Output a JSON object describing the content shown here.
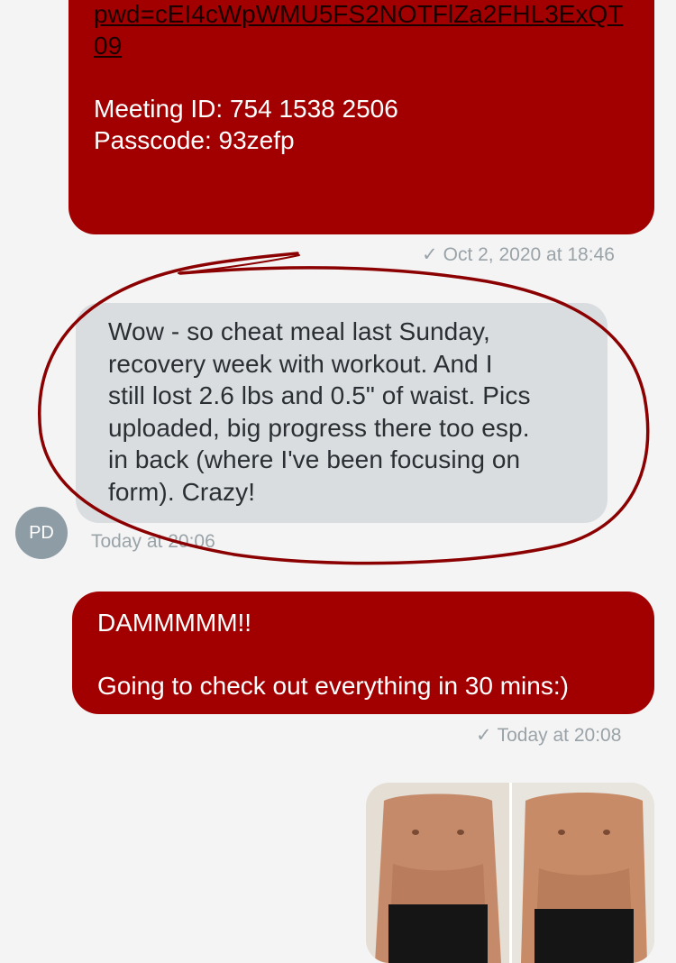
{
  "messages": [
    {
      "link_text": "pwd=cEI4cWpWMU5FS2NOTFlZa2FHL3ExQT09",
      "meeting_id": "Meeting ID: 754 1538 2506",
      "passcode": "Passcode: 93zefp",
      "timestamp": "Oct 2, 2020 at 18:46"
    },
    {
      "lines": [
        "Wow - so cheat meal last Sunday,",
        "recovery week with workout.  And I",
        "still lost 2.6 lbs and 0.5\" of waist.  Pics",
        "uploaded, big progress there too esp.",
        "in back (where I've been focusing on",
        "form).  Crazy!"
      ],
      "sender_initials": "PD",
      "timestamp": "Today at 20:06"
    },
    {
      "line1": "DAMMMMM!!",
      "line2": "Going to check out everything in 30 mins:)",
      "timestamp": "Today at 20:08"
    }
  ],
  "icons": {
    "check": "✓"
  },
  "colors": {
    "outgoing": "#a20000",
    "incoming": "#d9dde0",
    "annotation": "#8b0000"
  }
}
